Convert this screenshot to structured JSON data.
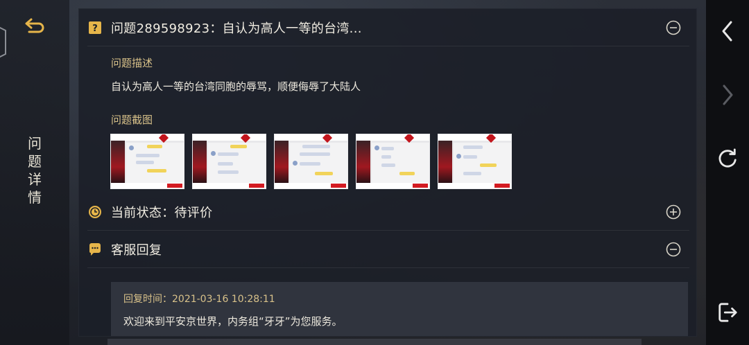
{
  "side": {
    "title_chars": [
      "问",
      "题",
      "详",
      "情"
    ]
  },
  "question": {
    "title": "问题289598923：自认为高人一等的台湾...",
    "desc_label": "问题描述",
    "desc_text": "自认为高人一等的台湾同胞的辱骂，顺便侮辱了大陆人",
    "screens_label": "问题截图",
    "screenshot_count": 5
  },
  "status": {
    "title": "当前状态：待评价"
  },
  "reply": {
    "title": "客服回复",
    "time_label": "回复时间：2021-03-16 10:28:11",
    "message": "欢迎来到平安京世界，内务组“牙牙”为您服务。"
  },
  "icons": {
    "back": "back-arrow-icon",
    "question": "question-mark-icon",
    "clock": "clock-icon",
    "chat": "chat-bubble-icon",
    "collapse": "minus-circle-icon",
    "expand": "plus-circle-icon",
    "nav_back": "chevron-left-icon",
    "nav_forward": "chevron-right-icon",
    "refresh": "refresh-icon",
    "exit": "exit-icon"
  },
  "colors": {
    "accent_gold": "#e6b54a",
    "label_gold": "#d9c28a",
    "text": "#ece8dd"
  }
}
